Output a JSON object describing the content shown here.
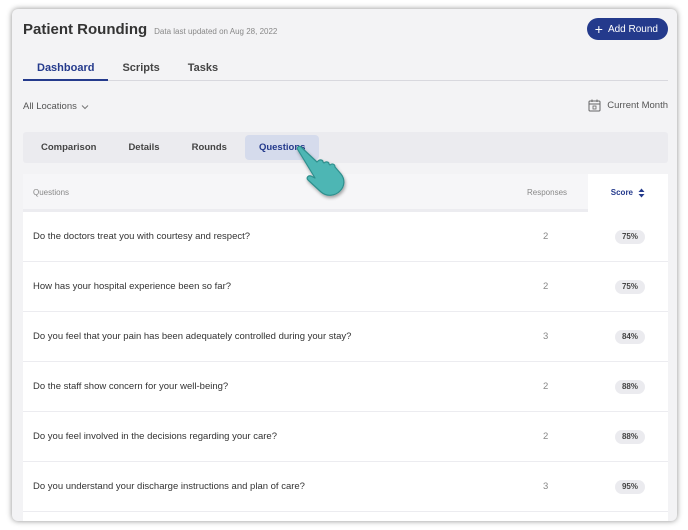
{
  "app": {
    "title": "Patient Rounding",
    "updated": "Data last updated on Aug 28, 2022"
  },
  "actions": {
    "add_round_label": "Add Round"
  },
  "main_tabs": [
    {
      "label": "Dashboard",
      "active": true
    },
    {
      "label": "Scripts",
      "active": false
    },
    {
      "label": "Tasks",
      "active": false
    }
  ],
  "filters": {
    "location": "All Locations",
    "period": "Current Month"
  },
  "sub_tabs": [
    {
      "label": "Comparison",
      "active": false
    },
    {
      "label": "Details",
      "active": false
    },
    {
      "label": "Rounds",
      "active": false
    },
    {
      "label": "Questions",
      "active": true
    }
  ],
  "table": {
    "headers": {
      "question": "Questions",
      "responses": "Responses",
      "score": "Score"
    },
    "rows": [
      {
        "question": "Do the doctors treat you with courtesy and respect?",
        "responses": "2",
        "score": "75%"
      },
      {
        "question": "How has your hospital experience been so far?",
        "responses": "2",
        "score": "75%"
      },
      {
        "question": "Do you feel that your pain has been adequately controlled during your stay?",
        "responses": "3",
        "score": "84%"
      },
      {
        "question": "Do the staff show concern for your well-being?",
        "responses": "2",
        "score": "88%"
      },
      {
        "question": "Do you feel involved in the decisions regarding your care?",
        "responses": "2",
        "score": "88%"
      },
      {
        "question": "Do you understand your discharge instructions and plan of care?",
        "responses": "3",
        "score": "95%"
      }
    ]
  },
  "colors": {
    "accent": "#243a8c",
    "cursor": "#4db6b4"
  }
}
